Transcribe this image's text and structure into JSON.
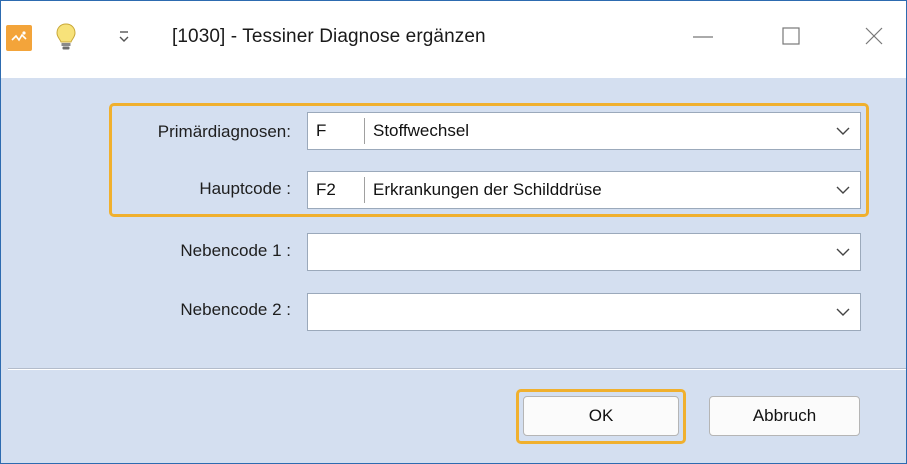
{
  "window": {
    "title": "[1030] - Tessiner Diagnose ergänzen"
  },
  "form": {
    "primary": {
      "label": "Primärdiagnosen:",
      "code": "F",
      "description": "Stoffwechsel"
    },
    "main": {
      "label": "Hauptcode :",
      "code": "F2",
      "description": "Erkrankungen der Schilddrüse"
    },
    "sub1": {
      "label": "Nebencode 1 :",
      "code": "",
      "description": ""
    },
    "sub2": {
      "label": "Nebencode 2 :",
      "code": "",
      "description": ""
    }
  },
  "buttons": {
    "ok": "OK",
    "cancel": "Abbruch"
  },
  "colors": {
    "highlight": "#f0b02e",
    "dialog_bg": "#d4dff0",
    "app_icon": "#f3a43a"
  }
}
